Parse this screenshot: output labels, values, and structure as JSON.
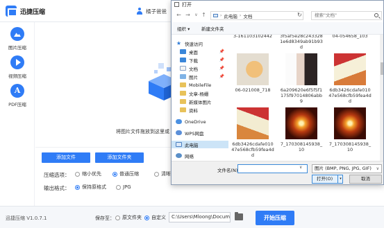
{
  "app": {
    "title": "迅捷压缩",
    "user_name": "橘子爸爸",
    "sidebar": [
      {
        "label": "图片压缩",
        "icon": "image-icon"
      },
      {
        "label": "视频压缩",
        "icon": "play-icon"
      },
      {
        "label": "PDF压缩",
        "icon": "pdf-icon"
      }
    ],
    "drop_hint": "将图片文件拖放到这里或",
    "add_file_label": "添加文件",
    "add_folder_label": "添加文件夹",
    "compress_label": "压缩选项：",
    "compress_options": [
      {
        "label": "缩小优先",
        "selected": false
      },
      {
        "label": "普通压缩",
        "selected": true
      },
      {
        "label": "清晰",
        "selected": false
      }
    ],
    "format_label": "输出格式：",
    "format_options": [
      {
        "label": "保持原格式",
        "selected": true
      },
      {
        "label": "JPG",
        "selected": false
      }
    ],
    "version": "迅捷压缩 V1.0.7.1",
    "save_to_label": "保存至：",
    "save_options": [
      {
        "label": "原文件夹",
        "selected": false
      },
      {
        "label": "自定义",
        "selected": true
      }
    ],
    "save_path": "C:\\Users\\Mloong\\Docume",
    "start_label": "开始压缩",
    "accent_color": "#2f7cf6"
  },
  "dialog": {
    "title": "打开",
    "breadcrumb": [
      "此电脑",
      "文档"
    ],
    "search_placeholder": "搜索\"文档\"",
    "toolbar": {
      "organize": "组织 ▾",
      "new_folder": "新建文件夹"
    },
    "nav_items": [
      {
        "label": "快速访问",
        "icon": "star-icon",
        "pinned": false
      },
      {
        "label": "桌面",
        "icon": "desktop-icon",
        "pinned": true
      },
      {
        "label": "下载",
        "icon": "download-icon",
        "pinned": true
      },
      {
        "label": "文档",
        "icon": "documents-icon",
        "pinned": true
      },
      {
        "label": "图片",
        "icon": "pictures-icon",
        "pinned": true
      },
      {
        "label": "MobileFile",
        "icon": "folder-icon",
        "pinned": false
      },
      {
        "label": "文章-杨姗",
        "icon": "folder-icon",
        "pinned": false
      },
      {
        "label": "新媒体图片",
        "icon": "folder-icon",
        "pinned": false
      },
      {
        "label": "资料",
        "icon": "folder-icon",
        "pinned": false
      },
      {
        "label": "OneDrive",
        "icon": "onedrive-icon",
        "pinned": false
      },
      {
        "label": "WPS网盘",
        "icon": "wps-cloud-icon",
        "pinned": false
      },
      {
        "label": "此电脑",
        "icon": "pc-icon",
        "pinned": false,
        "selected": true
      },
      {
        "label": "网络",
        "icon": "network-icon",
        "pinned": false
      }
    ],
    "pin_glyph": "📌",
    "files_top_captions": [
      "3-161103102442",
      "3f5af5e28c2433281e6d8349ab91b93d",
      "04-054658_103"
    ],
    "files": [
      {
        "caption": "06-021008_718",
        "thumb": "cat"
      },
      {
        "caption": "6a209620e6f5f5f1175f97014806abb9",
        "thumb": "face"
      },
      {
        "caption": "6db3426cdafe01047e568cfb59fea4dd",
        "thumb": "cake"
      },
      {
        "caption": "6db3426cdafe01047e568cfb59fea4dd",
        "thumb": "cake2"
      },
      {
        "caption": "7_170308145938_10",
        "thumb": "fire"
      },
      {
        "caption": "7_170308145938_10",
        "thumb": "fire"
      }
    ],
    "filename_label": "文件名(N):",
    "filename_value": "",
    "filter_label": "图片 (BMP, PNG, JPG, GIF)",
    "open_label": "打开(O)",
    "cancel_label": "取消"
  }
}
